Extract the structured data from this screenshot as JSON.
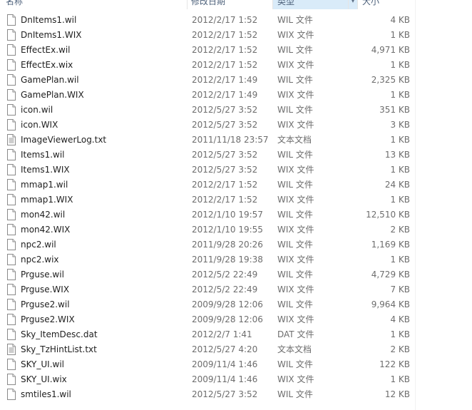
{
  "header": {
    "col_name": "名称",
    "col_date": "修改日期",
    "col_type": "类型",
    "col_size": "大小"
  },
  "files": [
    {
      "name": "DnItems1.wil",
      "date": "2012/2/17 1:52",
      "type": "WIL 文件",
      "size": "4 KB",
      "icon": "blank-file-icon"
    },
    {
      "name": "DnItems1.WIX",
      "date": "2012/2/17 1:52",
      "type": "WIX 文件",
      "size": "1 KB",
      "icon": "blank-file-icon"
    },
    {
      "name": "EffectEx.wil",
      "date": "2012/2/17 1:52",
      "type": "WIL 文件",
      "size": "4,971 KB",
      "icon": "blank-file-icon"
    },
    {
      "name": "EffectEx.wix",
      "date": "2012/2/17 1:52",
      "type": "WIX 文件",
      "size": "1 KB",
      "icon": "blank-file-icon"
    },
    {
      "name": "GamePlan.wil",
      "date": "2012/2/17 1:49",
      "type": "WIL 文件",
      "size": "2,325 KB",
      "icon": "blank-file-icon"
    },
    {
      "name": "GamePlan.WIX",
      "date": "2012/2/17 1:49",
      "type": "WIX 文件",
      "size": "1 KB",
      "icon": "blank-file-icon"
    },
    {
      "name": "icon.wil",
      "date": "2012/5/27 3:52",
      "type": "WIL 文件",
      "size": "351 KB",
      "icon": "blank-file-icon"
    },
    {
      "name": "icon.WIX",
      "date": "2012/5/27 3:52",
      "type": "WIX 文件",
      "size": "3 KB",
      "icon": "blank-file-icon"
    },
    {
      "name": "ImageViewerLog.txt",
      "date": "2011/11/18 23:57",
      "type": "文本文档",
      "size": "1 KB",
      "icon": "text-file-icon"
    },
    {
      "name": "Items1.wil",
      "date": "2012/5/27 3:52",
      "type": "WIL 文件",
      "size": "13 KB",
      "icon": "blank-file-icon"
    },
    {
      "name": "Items1.WIX",
      "date": "2012/5/27 3:52",
      "type": "WIX 文件",
      "size": "1 KB",
      "icon": "blank-file-icon"
    },
    {
      "name": "mmap1.wil",
      "date": "2012/2/17 1:52",
      "type": "WIL 文件",
      "size": "24 KB",
      "icon": "blank-file-icon"
    },
    {
      "name": "mmap1.WIX",
      "date": "2012/2/17 1:52",
      "type": "WIX 文件",
      "size": "1 KB",
      "icon": "blank-file-icon"
    },
    {
      "name": "mon42.wil",
      "date": "2012/1/10 19:57",
      "type": "WIL 文件",
      "size": "12,510 KB",
      "icon": "blank-file-icon"
    },
    {
      "name": "mon42.WIX",
      "date": "2012/1/10 19:55",
      "type": "WIX 文件",
      "size": "2 KB",
      "icon": "blank-file-icon"
    },
    {
      "name": "npc2.wil",
      "date": "2011/9/28 20:26",
      "type": "WIL 文件",
      "size": "1,169 KB",
      "icon": "blank-file-icon"
    },
    {
      "name": "npc2.wix",
      "date": "2011/9/28 19:38",
      "type": "WIX 文件",
      "size": "1 KB",
      "icon": "blank-file-icon"
    },
    {
      "name": "Prguse.wil",
      "date": "2012/5/2 22:49",
      "type": "WIL 文件",
      "size": "4,729 KB",
      "icon": "blank-file-icon"
    },
    {
      "name": "Prguse.WIX",
      "date": "2012/5/2 22:49",
      "type": "WIX 文件",
      "size": "7 KB",
      "icon": "blank-file-icon"
    },
    {
      "name": "Prguse2.wil",
      "date": "2009/9/28 12:06",
      "type": "WIL 文件",
      "size": "9,964 KB",
      "icon": "blank-file-icon"
    },
    {
      "name": "Prguse2.WIX",
      "date": "2009/9/28 12:06",
      "type": "WIX 文件",
      "size": "4 KB",
      "icon": "blank-file-icon"
    },
    {
      "name": "Sky_ItemDesc.dat",
      "date": "2012/2/7 1:41",
      "type": "DAT 文件",
      "size": "1 KB",
      "icon": "blank-file-icon"
    },
    {
      "name": "Sky_TzHintList.txt",
      "date": "2012/5/27 4:20",
      "type": "文本文档",
      "size": "2 KB",
      "icon": "text-file-icon"
    },
    {
      "name": "SKY_UI.wil",
      "date": "2009/11/4 1:46",
      "type": "WIL 文件",
      "size": "122 KB",
      "icon": "blank-file-icon"
    },
    {
      "name": "SKY_UI.wix",
      "date": "2009/11/4 1:46",
      "type": "WIX 文件",
      "size": "1 KB",
      "icon": "blank-file-icon"
    },
    {
      "name": "smtiles1.wil",
      "date": "2012/5/27 3:52",
      "type": "WIL 文件",
      "size": "12 KB",
      "icon": "blank-file-icon"
    }
  ]
}
